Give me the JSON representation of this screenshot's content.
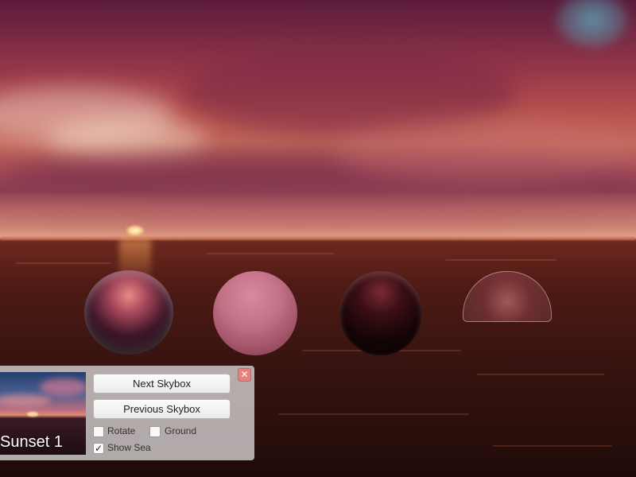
{
  "scene": {
    "objects": [
      "chrome-sphere",
      "matte-sphere",
      "glossy-sphere",
      "glass-dome"
    ]
  },
  "panel": {
    "skybox_name": "Sunset 1",
    "next_button": "Next Skybox",
    "previous_button": "Previous Skybox",
    "close_icon": "close-icon",
    "close_glyph": "✕",
    "options": [
      {
        "label": "Rotate",
        "checked": false
      },
      {
        "label": "Ground",
        "checked": false
      },
      {
        "label": "Show Sea",
        "checked": true
      }
    ]
  },
  "colors": {
    "close_button": "#e5807f",
    "panel_bg": "#e8e8e8"
  }
}
